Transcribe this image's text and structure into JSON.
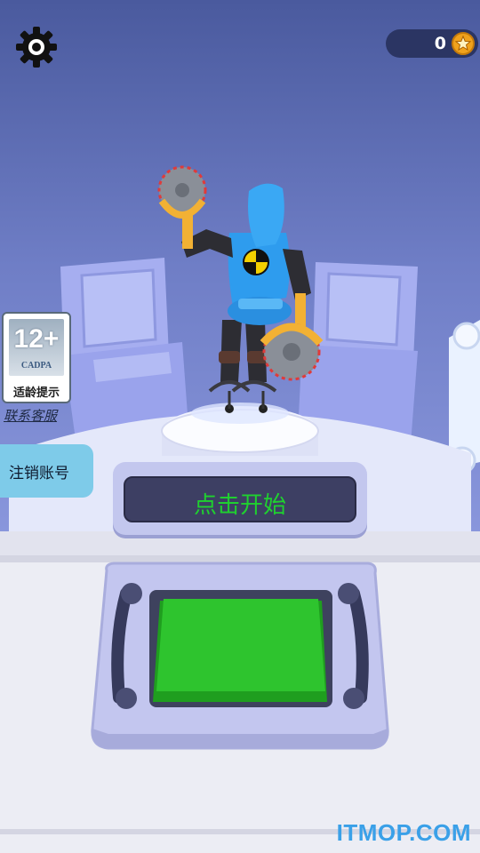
{
  "hud": {
    "coins": "0",
    "settings_icon": "gear-icon",
    "coin_icon": "star-coin-icon"
  },
  "age_rating": {
    "number": "12+",
    "org": "CADPA",
    "label": "适龄提示"
  },
  "links": {
    "support": "联系客服",
    "logout": "注销账号"
  },
  "start": {
    "label": "点击开始"
  },
  "watermark": "ITMOP.COM",
  "colors": {
    "background": "#4a5a9e",
    "start_text": "#1fd12f",
    "big_button": "#2ec42e",
    "robot_body": "#2ea0f0",
    "console": "#a9b0f0"
  }
}
